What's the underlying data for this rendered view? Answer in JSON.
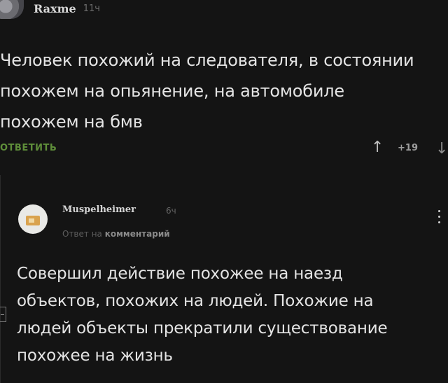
{
  "comment1": {
    "author": "Raxme",
    "time": "11ч",
    "text_lines": [
      "Человек похожий на следователя, в состоянии",
      "похожем на опьянение, на автомобиле",
      "похожем на бмв"
    ],
    "reply_label": "ОТВЕТИТЬ",
    "upvote_icon": "arrow-up",
    "score": "+19",
    "downvote_icon": "arrow-down"
  },
  "comment2": {
    "author": "Muspelheimer",
    "time": "6ч",
    "reply_to_prefix": "Ответ на",
    "reply_to_link": "комментарий",
    "text_lines": [
      "Совершил действие похожее на наезд",
      "объектов, похожих на людей. Похожие на",
      "людей объекты прекратили существование",
      "похожее на жизнь"
    ]
  },
  "colors": {
    "background": "#141414",
    "text": "#e4e4e4",
    "reply_green": "#5f8f3a",
    "muted": "#666666"
  }
}
